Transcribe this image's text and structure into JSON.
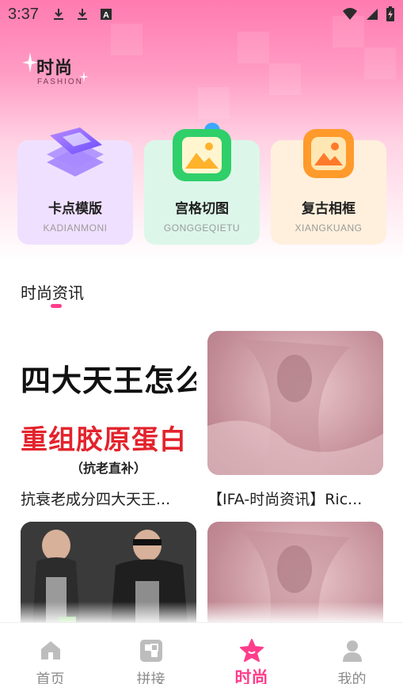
{
  "status_bar": {
    "time": "3:37",
    "left_icons": [
      "download-icon",
      "download-icon",
      "a-box-icon"
    ],
    "right_icons": [
      "wifi-icon",
      "signal-icon",
      "battery-charging-icon"
    ]
  },
  "brand": {
    "title": "时尚",
    "subtitle": "FASHION"
  },
  "features": [
    {
      "title": "卡点模版",
      "subtitle": "KADIANMONI",
      "icon": "stack-cards-icon",
      "bg": "#f0e0ff"
    },
    {
      "title": "宫格切图",
      "subtitle": "GONGGEQIETU",
      "icon": "grid-image-icon",
      "bg": "#dcf7e9"
    },
    {
      "title": "复古相框",
      "subtitle": "XIANGKUANG",
      "icon": "photo-frame-icon",
      "bg": "#fff0dd"
    }
  ],
  "section": {
    "title": "时尚资讯",
    "accent": "#ff3d8b"
  },
  "news": [
    {
      "caption": "抗衰老成分四大天王...",
      "image_lines": [
        "四大天王怎么",
        "重组胶原蛋白",
        "（抗老直补）"
      ]
    },
    {
      "caption": "【IFA-时尚资讯】Ric..."
    },
    {
      "caption": ""
    },
    {
      "caption": ""
    }
  ],
  "nav": {
    "active": 2,
    "items": [
      {
        "label": "首页",
        "icon": "home-icon"
      },
      {
        "label": "拼接",
        "icon": "collage-icon"
      },
      {
        "label": "时尚",
        "icon": "star-icon"
      },
      {
        "label": "我的",
        "icon": "user-icon"
      }
    ]
  },
  "colors": {
    "accent": "#ff3d8b",
    "header_pink": "#ff7bb0"
  }
}
